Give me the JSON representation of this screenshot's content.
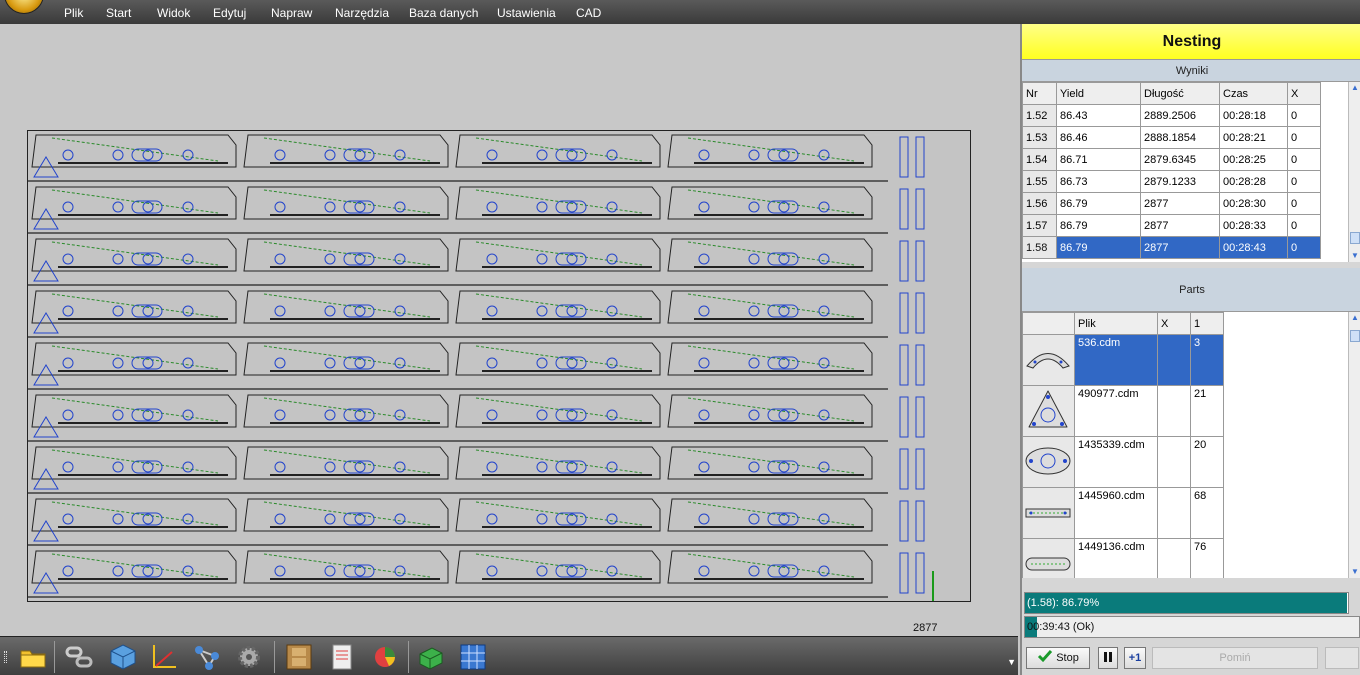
{
  "menu": [
    "Plik",
    "Start",
    "Widok",
    "Edytuj",
    "Napraw",
    "Narzędzia",
    "Baza danych",
    "Ustawienia",
    "CAD"
  ],
  "canvas": {
    "sheet_length_label": "2877"
  },
  "toolbar": {
    "icons": [
      "folder-icon",
      "chain-link-icon",
      "cube-icon",
      "axes-icon",
      "network-icon",
      "gear-icon",
      "film-icon",
      "document-icon",
      "pie-chart-icon",
      "green-block-icon",
      "grid-layout-icon"
    ]
  },
  "panel": {
    "title": "Nesting",
    "results_heading": "Wyniki",
    "results_columns": [
      "Nr",
      "Yield",
      "Długość",
      "Czas",
      "X"
    ],
    "results_rows": [
      {
        "nr": "1.52",
        "yield": "86.43",
        "length": "2889.2506",
        "time": "00:28:18",
        "x": "0"
      },
      {
        "nr": "1.53",
        "yield": "86.46",
        "length": "2888.1854",
        "time": "00:28:21",
        "x": "0"
      },
      {
        "nr": "1.54",
        "yield": "86.71",
        "length": "2879.6345",
        "time": "00:28:25",
        "x": "0"
      },
      {
        "nr": "1.55",
        "yield": "86.73",
        "length": "2879.1233",
        "time": "00:28:28",
        "x": "0"
      },
      {
        "nr": "1.56",
        "yield": "86.79",
        "length": "2877",
        "time": "00:28:30",
        "x": "0"
      },
      {
        "nr": "1.57",
        "yield": "86.79",
        "length": "2877",
        "time": "00:28:33",
        "x": "0"
      },
      {
        "nr": "1.58",
        "yield": "86.79",
        "length": "2877",
        "time": "00:28:43",
        "x": "0",
        "selected": true
      }
    ],
    "parts_heading": "Parts",
    "parts_columns": [
      "",
      "Plik",
      "X",
      "1"
    ],
    "parts_rows": [
      {
        "file": "536.cdm",
        "x": "",
        "qty": "3",
        "thumb": "arc-part",
        "selected": true
      },
      {
        "file": "490977.cdm",
        "x": "",
        "qty": "21",
        "thumb": "triangle-part"
      },
      {
        "file": "1435339.cdm",
        "x": "",
        "qty": "20",
        "thumb": "oval-part"
      },
      {
        "file": "1445960.cdm",
        "x": "",
        "qty": "68",
        "thumb": "bar-part"
      },
      {
        "file": "1449136.cdm",
        "x": "",
        "qty": "76",
        "thumb": "slot-part"
      }
    ],
    "progress_text": "(1.58): 86.79%",
    "progress_fraction": 0.9969,
    "time_text": "00:39:43 (Ok)",
    "time_fraction": 0.035,
    "stop_label": "Stop",
    "plus_one_label": "+1",
    "skip_label": "Pomiń",
    "colors": {
      "accent": "#3168c5",
      "progress": "#0a7b7b",
      "title_bg": "#ffff20"
    }
  }
}
